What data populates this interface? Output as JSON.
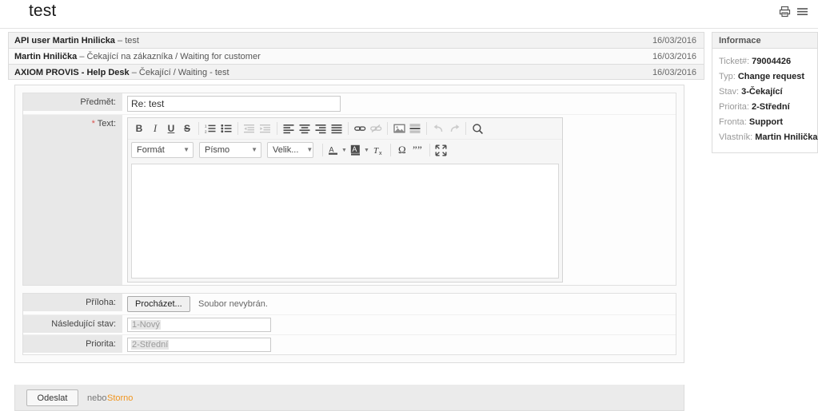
{
  "header": {
    "title": "test",
    "icons": [
      {
        "name": "print-icon",
        "label": "Tisk"
      },
      {
        "name": "hamburger-menu-icon",
        "label": "Menu"
      }
    ]
  },
  "articles": [
    {
      "author": "API user Martin Hnilicka",
      "dash": "–",
      "subject": "test",
      "date": "16/03/2016"
    },
    {
      "author": "Martin Hnilička",
      "dash": "–",
      "subject": "Čekající na zákazníka / Waiting for customer",
      "date": "16/03/2016"
    },
    {
      "author": "AXIOM PROVIS - Help Desk",
      "dash": "–",
      "subject": "Čekající / Waiting - test",
      "date": "16/03/2016"
    }
  ],
  "sidebar": {
    "title": "Informace",
    "rows": [
      {
        "label": "Ticket#:",
        "value": "79004426"
      },
      {
        "label": "Typ:",
        "value": "Change request"
      },
      {
        "label": "Stav:",
        "value": "3-Čekající"
      },
      {
        "label": "Priorita:",
        "value": "2-Střední"
      },
      {
        "label": "Fronta:",
        "value": "Support"
      },
      {
        "label": "Vlastník:",
        "value": "Martin Hnilička"
      }
    ]
  },
  "form": {
    "subject": {
      "label": "Předmět:",
      "value": "Re: test"
    },
    "text": {
      "label": "Text:",
      "required_mark": "*",
      "value": ""
    },
    "attachment": {
      "label": "Příloha:",
      "browse_label": "Procházet...",
      "no_file_text": "Soubor nevybrán."
    },
    "next_state": {
      "label": "Následující stav:",
      "value": "1-Nový"
    },
    "priority": {
      "label": "Priorita:",
      "value": "2-Střední"
    }
  },
  "editor": {
    "toolbar_row1": [
      {
        "name": "bold-icon",
        "glyph": "B"
      },
      {
        "name": "italic-icon",
        "glyph": "I"
      },
      {
        "name": "underline-icon",
        "glyph": "U"
      },
      {
        "name": "strikethrough-icon",
        "glyph": "S"
      },
      {
        "name": "numbered-list-icon",
        "glyph": ""
      },
      {
        "name": "bulleted-list-icon",
        "glyph": ""
      },
      {
        "name": "decrease-indent-icon",
        "glyph": ""
      },
      {
        "name": "increase-indent-icon",
        "glyph": ""
      },
      {
        "name": "align-left-icon",
        "glyph": ""
      },
      {
        "name": "align-center-icon",
        "glyph": ""
      },
      {
        "name": "align-right-icon",
        "glyph": ""
      },
      {
        "name": "align-justify-icon",
        "glyph": ""
      },
      {
        "name": "link-icon",
        "glyph": ""
      },
      {
        "name": "unlink-icon",
        "glyph": ""
      },
      {
        "name": "image-icon",
        "glyph": ""
      },
      {
        "name": "horizontal-rule-icon",
        "glyph": ""
      },
      {
        "name": "undo-icon",
        "glyph": ""
      },
      {
        "name": "redo-icon",
        "glyph": ""
      },
      {
        "name": "find-icon",
        "glyph": ""
      }
    ],
    "combos": [
      {
        "name": "format-dropdown",
        "label": "Formát"
      },
      {
        "name": "font-dropdown",
        "label": "Písmo"
      },
      {
        "name": "size-dropdown",
        "label": "Velik..."
      }
    ],
    "toolbar_row2": [
      {
        "name": "text-color-icon",
        "glyph": "A"
      },
      {
        "name": "background-color-icon",
        "glyph": "A"
      },
      {
        "name": "remove-format-icon",
        "glyph": "Tx"
      },
      {
        "name": "special-character-icon",
        "glyph": "Ω"
      },
      {
        "name": "blockquote-icon",
        "glyph": "ʕʕ"
      },
      {
        "name": "maximize-icon",
        "glyph": ""
      }
    ],
    "content": ""
  },
  "footer": {
    "submit_label": "Odeslat",
    "or_label": "nebo",
    "cancel_label": "Storno"
  },
  "colors": {
    "accent_orange": "#f0951e",
    "required_red": "#d9534f",
    "row_bg": "#f2f2f2",
    "label_bg": "#e8e8e8"
  }
}
